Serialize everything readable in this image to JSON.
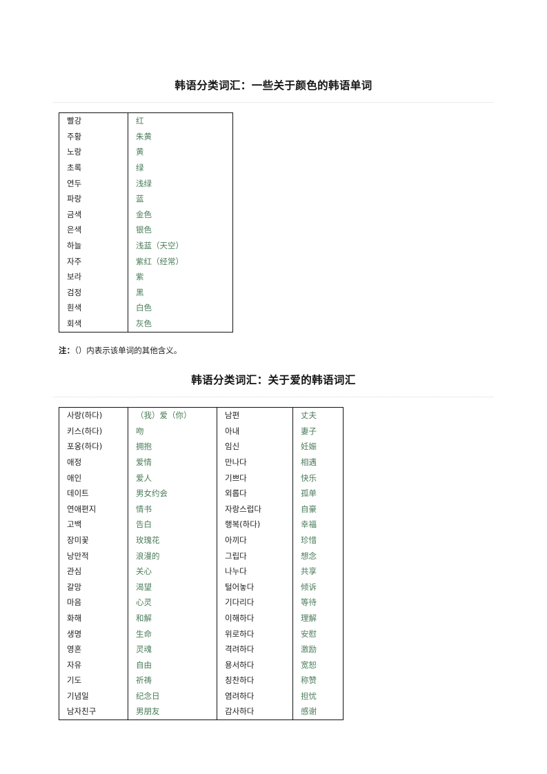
{
  "document": {
    "sections": [
      {
        "heading": "韩语分类词汇：一些关于颜色的韩语单词",
        "table": {
          "columns": [
            "korean",
            "chinese"
          ],
          "rows": [
            {
              "korean": "빨강",
              "chinese": "红"
            },
            {
              "korean": "주황",
              "chinese": "朱黄"
            },
            {
              "korean": "노랑",
              "chinese": "黄"
            },
            {
              "korean": "초록",
              "chinese": "绿"
            },
            {
              "korean": "연두",
              "chinese": "浅绿"
            },
            {
              "korean": "파랑",
              "chinese": "蓝"
            },
            {
              "korean": "금색",
              "chinese": "金色"
            },
            {
              "korean": "은색",
              "chinese": "银色"
            },
            {
              "korean": "하늘",
              "chinese": "浅蓝（天空）"
            },
            {
              "korean": "자주",
              "chinese": "紫红（经常）"
            },
            {
              "korean": "보라",
              "chinese": "紫"
            },
            {
              "korean": "검정",
              "chinese": "黑"
            },
            {
              "korean": "흰색",
              "chinese": "白色"
            },
            {
              "korean": "회색",
              "chinese": "灰色"
            }
          ]
        },
        "note_label": "注：",
        "note_text": "（）内表示该单词的其他含义。"
      },
      {
        "heading": "韩语分类词汇：关于爱的韩语词汇",
        "table": {
          "columns": [
            "korean_a",
            "chinese_a",
            "korean_b",
            "chinese_b"
          ],
          "rows": [
            {
              "korean_a": "사랑(하다)",
              "chinese_a": "（我）爱（你）",
              "korean_b": "남편",
              "chinese_b": "丈夫"
            },
            {
              "korean_a": "키스(하다)",
              "chinese_a": "吻",
              "korean_b": "아내",
              "chinese_b": "妻子"
            },
            {
              "korean_a": "포옹(하다)",
              "chinese_a": "拥抱",
              "korean_b": "임신",
              "chinese_b": "妊娠"
            },
            {
              "korean_a": "애정",
              "chinese_a": "爱情",
              "korean_b": "만나다",
              "chinese_b": "相遇"
            },
            {
              "korean_a": "애인",
              "chinese_a": "爱人",
              "korean_b": "기쁘다",
              "chinese_b": "快乐"
            },
            {
              "korean_a": "데이트",
              "chinese_a": "男女约会",
              "korean_b": "외롭다",
              "chinese_b": "孤单"
            },
            {
              "korean_a": "연애편지",
              "chinese_a": "情书",
              "korean_b": "자랑스럽다",
              "chinese_b": "自豪"
            },
            {
              "korean_a": "고백",
              "chinese_a": "告白",
              "korean_b": "행복(하다)",
              "chinese_b": "幸福"
            },
            {
              "korean_a": "장미꽃",
              "chinese_a": "玫瑰花",
              "korean_b": "아끼다",
              "chinese_b": "珍惜"
            },
            {
              "korean_a": "낭만적",
              "chinese_a": "浪漫的",
              "korean_b": "그립다",
              "chinese_b": "想念"
            },
            {
              "korean_a": "관심",
              "chinese_a": "关心",
              "korean_b": "나누다",
              "chinese_b": "共享"
            },
            {
              "korean_a": "갈망",
              "chinese_a": "渴望",
              "korean_b": "털어놓다",
              "chinese_b": "倾诉"
            },
            {
              "korean_a": "마음",
              "chinese_a": "心灵",
              "korean_b": "기다리다",
              "chinese_b": "等待"
            },
            {
              "korean_a": "화해",
              "chinese_a": "和解",
              "korean_b": "이해하다",
              "chinese_b": "理解"
            },
            {
              "korean_a": "생명",
              "chinese_a": "生命",
              "korean_b": "위로하다",
              "chinese_b": "安慰"
            },
            {
              "korean_a": "영혼",
              "chinese_a": "灵魂",
              "korean_b": "격려하다",
              "chinese_b": "激励"
            },
            {
              "korean_a": "자유",
              "chinese_a": "自由",
              "korean_b": "용서하다",
              "chinese_b": "宽恕"
            },
            {
              "korean_a": "기도",
              "chinese_a": "祈祷",
              "korean_b": "칭찬하다",
              "chinese_b": "称赞"
            },
            {
              "korean_a": "기념일",
              "chinese_a": "纪念日",
              "korean_b": "염려하다",
              "chinese_b": "担忧"
            },
            {
              "korean_a": "남자친구",
              "chinese_a": "男朋友",
              "korean_b": "감사하다",
              "chinese_b": "感谢"
            }
          ]
        }
      }
    ],
    "colors": {
      "translation_green": "#4a7c59",
      "text_black": "#1a1a1a",
      "table_border": "#111111",
      "rule_gray": "#d8d8d8"
    }
  }
}
